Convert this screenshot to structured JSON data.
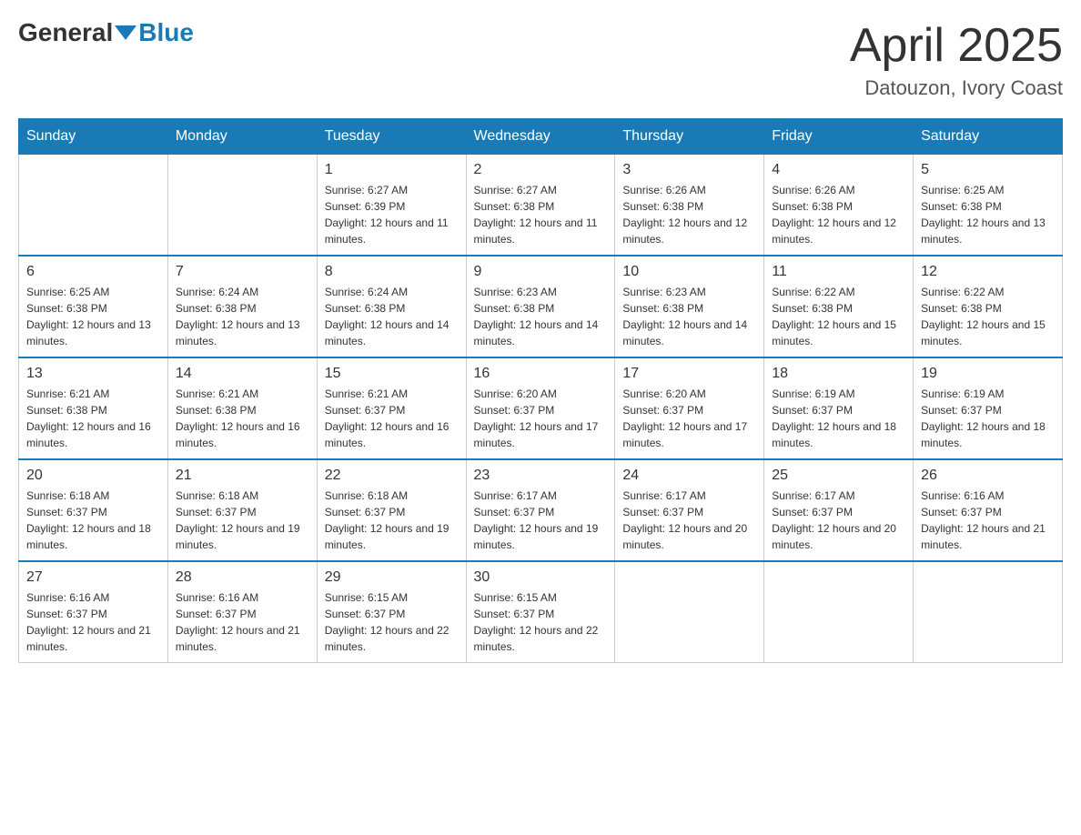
{
  "header": {
    "logo_general": "General",
    "logo_blue": "Blue",
    "title": "April 2025",
    "subtitle": "Datouzon, Ivory Coast"
  },
  "days_of_week": [
    "Sunday",
    "Monday",
    "Tuesday",
    "Wednesday",
    "Thursday",
    "Friday",
    "Saturday"
  ],
  "weeks": [
    [
      {
        "day": "",
        "sunrise": "",
        "sunset": "",
        "daylight": ""
      },
      {
        "day": "",
        "sunrise": "",
        "sunset": "",
        "daylight": ""
      },
      {
        "day": "1",
        "sunrise": "Sunrise: 6:27 AM",
        "sunset": "Sunset: 6:39 PM",
        "daylight": "Daylight: 12 hours and 11 minutes."
      },
      {
        "day": "2",
        "sunrise": "Sunrise: 6:27 AM",
        "sunset": "Sunset: 6:38 PM",
        "daylight": "Daylight: 12 hours and 11 minutes."
      },
      {
        "day": "3",
        "sunrise": "Sunrise: 6:26 AM",
        "sunset": "Sunset: 6:38 PM",
        "daylight": "Daylight: 12 hours and 12 minutes."
      },
      {
        "day": "4",
        "sunrise": "Sunrise: 6:26 AM",
        "sunset": "Sunset: 6:38 PM",
        "daylight": "Daylight: 12 hours and 12 minutes."
      },
      {
        "day": "5",
        "sunrise": "Sunrise: 6:25 AM",
        "sunset": "Sunset: 6:38 PM",
        "daylight": "Daylight: 12 hours and 13 minutes."
      }
    ],
    [
      {
        "day": "6",
        "sunrise": "Sunrise: 6:25 AM",
        "sunset": "Sunset: 6:38 PM",
        "daylight": "Daylight: 12 hours and 13 minutes."
      },
      {
        "day": "7",
        "sunrise": "Sunrise: 6:24 AM",
        "sunset": "Sunset: 6:38 PM",
        "daylight": "Daylight: 12 hours and 13 minutes."
      },
      {
        "day": "8",
        "sunrise": "Sunrise: 6:24 AM",
        "sunset": "Sunset: 6:38 PM",
        "daylight": "Daylight: 12 hours and 14 minutes."
      },
      {
        "day": "9",
        "sunrise": "Sunrise: 6:23 AM",
        "sunset": "Sunset: 6:38 PM",
        "daylight": "Daylight: 12 hours and 14 minutes."
      },
      {
        "day": "10",
        "sunrise": "Sunrise: 6:23 AM",
        "sunset": "Sunset: 6:38 PM",
        "daylight": "Daylight: 12 hours and 14 minutes."
      },
      {
        "day": "11",
        "sunrise": "Sunrise: 6:22 AM",
        "sunset": "Sunset: 6:38 PM",
        "daylight": "Daylight: 12 hours and 15 minutes."
      },
      {
        "day": "12",
        "sunrise": "Sunrise: 6:22 AM",
        "sunset": "Sunset: 6:38 PM",
        "daylight": "Daylight: 12 hours and 15 minutes."
      }
    ],
    [
      {
        "day": "13",
        "sunrise": "Sunrise: 6:21 AM",
        "sunset": "Sunset: 6:38 PM",
        "daylight": "Daylight: 12 hours and 16 minutes."
      },
      {
        "day": "14",
        "sunrise": "Sunrise: 6:21 AM",
        "sunset": "Sunset: 6:38 PM",
        "daylight": "Daylight: 12 hours and 16 minutes."
      },
      {
        "day": "15",
        "sunrise": "Sunrise: 6:21 AM",
        "sunset": "Sunset: 6:37 PM",
        "daylight": "Daylight: 12 hours and 16 minutes."
      },
      {
        "day": "16",
        "sunrise": "Sunrise: 6:20 AM",
        "sunset": "Sunset: 6:37 PM",
        "daylight": "Daylight: 12 hours and 17 minutes."
      },
      {
        "day": "17",
        "sunrise": "Sunrise: 6:20 AM",
        "sunset": "Sunset: 6:37 PM",
        "daylight": "Daylight: 12 hours and 17 minutes."
      },
      {
        "day": "18",
        "sunrise": "Sunrise: 6:19 AM",
        "sunset": "Sunset: 6:37 PM",
        "daylight": "Daylight: 12 hours and 18 minutes."
      },
      {
        "day": "19",
        "sunrise": "Sunrise: 6:19 AM",
        "sunset": "Sunset: 6:37 PM",
        "daylight": "Daylight: 12 hours and 18 minutes."
      }
    ],
    [
      {
        "day": "20",
        "sunrise": "Sunrise: 6:18 AM",
        "sunset": "Sunset: 6:37 PM",
        "daylight": "Daylight: 12 hours and 18 minutes."
      },
      {
        "day": "21",
        "sunrise": "Sunrise: 6:18 AM",
        "sunset": "Sunset: 6:37 PM",
        "daylight": "Daylight: 12 hours and 19 minutes."
      },
      {
        "day": "22",
        "sunrise": "Sunrise: 6:18 AM",
        "sunset": "Sunset: 6:37 PM",
        "daylight": "Daylight: 12 hours and 19 minutes."
      },
      {
        "day": "23",
        "sunrise": "Sunrise: 6:17 AM",
        "sunset": "Sunset: 6:37 PM",
        "daylight": "Daylight: 12 hours and 19 minutes."
      },
      {
        "day": "24",
        "sunrise": "Sunrise: 6:17 AM",
        "sunset": "Sunset: 6:37 PM",
        "daylight": "Daylight: 12 hours and 20 minutes."
      },
      {
        "day": "25",
        "sunrise": "Sunrise: 6:17 AM",
        "sunset": "Sunset: 6:37 PM",
        "daylight": "Daylight: 12 hours and 20 minutes."
      },
      {
        "day": "26",
        "sunrise": "Sunrise: 6:16 AM",
        "sunset": "Sunset: 6:37 PM",
        "daylight": "Daylight: 12 hours and 21 minutes."
      }
    ],
    [
      {
        "day": "27",
        "sunrise": "Sunrise: 6:16 AM",
        "sunset": "Sunset: 6:37 PM",
        "daylight": "Daylight: 12 hours and 21 minutes."
      },
      {
        "day": "28",
        "sunrise": "Sunrise: 6:16 AM",
        "sunset": "Sunset: 6:37 PM",
        "daylight": "Daylight: 12 hours and 21 minutes."
      },
      {
        "day": "29",
        "sunrise": "Sunrise: 6:15 AM",
        "sunset": "Sunset: 6:37 PM",
        "daylight": "Daylight: 12 hours and 22 minutes."
      },
      {
        "day": "30",
        "sunrise": "Sunrise: 6:15 AM",
        "sunset": "Sunset: 6:37 PM",
        "daylight": "Daylight: 12 hours and 22 minutes."
      },
      {
        "day": "",
        "sunrise": "",
        "sunset": "",
        "daylight": ""
      },
      {
        "day": "",
        "sunrise": "",
        "sunset": "",
        "daylight": ""
      },
      {
        "day": "",
        "sunrise": "",
        "sunset": "",
        "daylight": ""
      }
    ]
  ]
}
